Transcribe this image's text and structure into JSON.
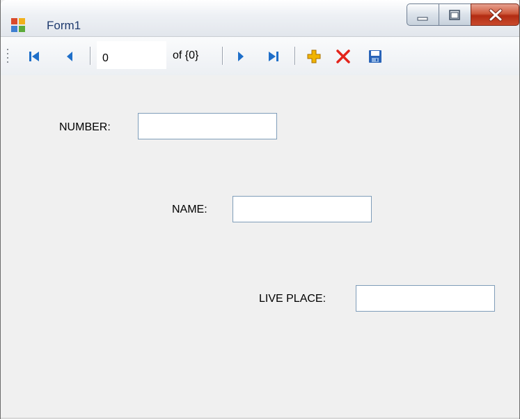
{
  "window": {
    "title": "Form1",
    "app_icon": "form-app-icon",
    "caption_buttons": [
      "minimize-icon",
      "maximize-icon",
      "close-icon"
    ]
  },
  "navigator": {
    "position_value": "0",
    "count_label": "of {0}",
    "buttons": [
      "move-first-icon",
      "move-previous-icon",
      "move-next-icon",
      "move-last-icon",
      "add-new-icon",
      "delete-icon",
      "save-icon"
    ]
  },
  "fields": {
    "number": {
      "label": "NUMBER:",
      "value": ""
    },
    "name": {
      "label": "NAME:",
      "value": ""
    },
    "live_place": {
      "label": "LIVE PLACE:",
      "value": ""
    }
  },
  "colors": {
    "nav_arrow": "#1f6fc9",
    "add_icon": "#f0b400",
    "delete_icon": "#e3241b",
    "save_icon": "#2a64b8",
    "close_button": "#c94a2d"
  }
}
